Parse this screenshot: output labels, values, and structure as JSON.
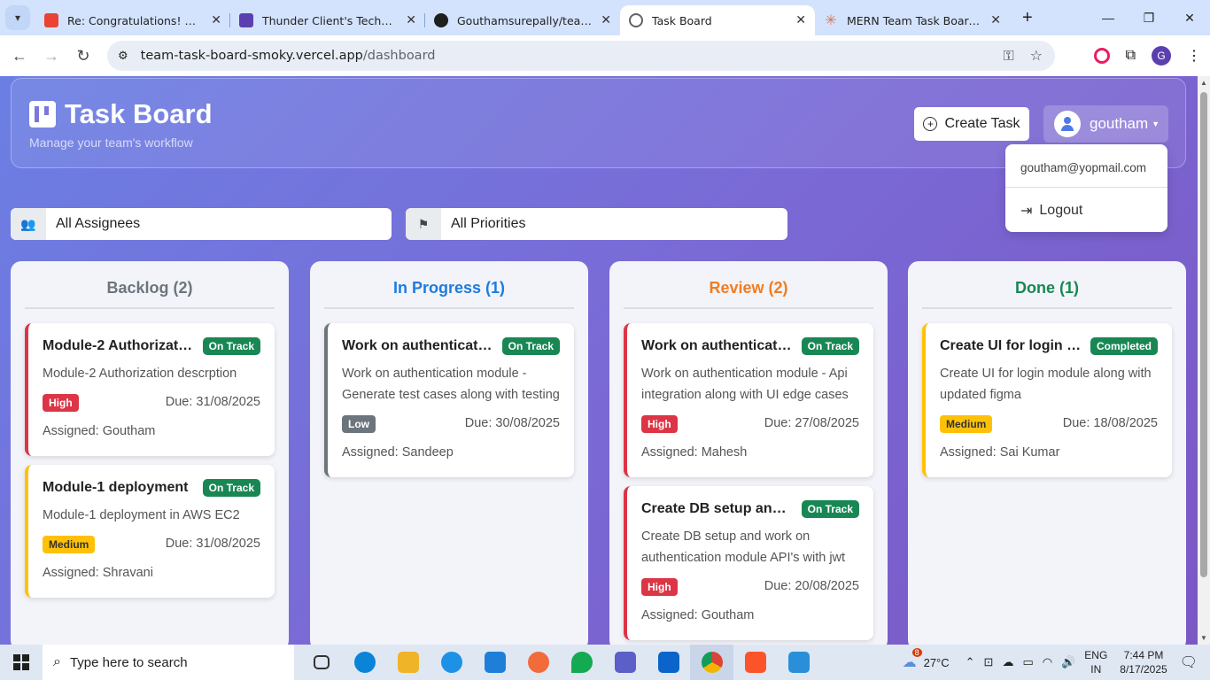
{
  "browser": {
    "tabs": [
      {
        "title": "Re: Congratulations! Next Ste",
        "favicon_color": "#ea4335",
        "icon": "gmail-icon"
      },
      {
        "title": "Thunder Client's Technical As",
        "favicon_color": "#5b3fb0",
        "icon": "thunder-client-icon"
      },
      {
        "title": "Gouthamsurepally/team-task",
        "favicon_color": "#1f1f1f",
        "icon": "github-icon"
      },
      {
        "title": "Task Board",
        "favicon_color": "#5f6368",
        "icon": "globe-icon",
        "active": true
      },
      {
        "title": "MERN Team Task Board Proje",
        "favicon_color": "#d97757",
        "icon": "claude-icon"
      }
    ],
    "url_host": "team-task-board-smoky.vercel.app",
    "url_path": "/dashboard",
    "profile_initial": "G"
  },
  "app": {
    "title": "Task Board",
    "subtitle": "Manage your team's workflow",
    "create_label": "Create Task",
    "username": "goutham",
    "menu": {
      "email": "goutham@yopmail.com",
      "logout": "Logout"
    },
    "filters": {
      "assignee": "All Assignees",
      "priority": "All Priorities"
    }
  },
  "columns": [
    {
      "title": "Backlog (2)",
      "color": "#6c757d",
      "cards": [
        {
          "title": "Module-2 Authorizati...",
          "status": "On Track",
          "desc": "Module-2 Authorization descrption",
          "priority": "High",
          "due": "Due: 31/08/2025",
          "assigned": "Assigned: Goutham"
        },
        {
          "title": "Module-1 deployment",
          "status": "On Track",
          "desc": "Module-1 deployment in AWS EC2",
          "priority": "Medium",
          "due": "Due: 31/08/2025",
          "assigned": "Assigned: Shravani"
        }
      ]
    },
    {
      "title": "In Progress (1)",
      "color": "#1c7ce0",
      "cards": [
        {
          "title": "Work on authenticati...",
          "status": "On Track",
          "desc": "Work on authentication module - Generate test cases along with testing",
          "priority": "Low",
          "due": "Due: 30/08/2025",
          "assigned": "Assigned: Sandeep"
        }
      ]
    },
    {
      "title": "Review (2)",
      "color": "#f07d22",
      "cards": [
        {
          "title": "Work on authenticati...",
          "status": "On Track",
          "desc": "Work on authentication module - Api integration along with UI edge cases",
          "priority": "High",
          "due": "Due: 27/08/2025",
          "assigned": "Assigned: Mahesh"
        },
        {
          "title": "Create DB setup and ...",
          "status": "On Track",
          "desc": "Create DB setup and work on authentication module API's with jwt",
          "priority": "High",
          "due": "Due: 20/08/2025",
          "assigned": "Assigned: Goutham"
        }
      ]
    },
    {
      "title": "Done (1)",
      "color": "#198754",
      "cards": [
        {
          "title": "Create UI for login m...",
          "status": "Completed",
          "desc": "Create UI for login module along with updated figma",
          "priority": "Medium",
          "due": "Due: 18/08/2025",
          "assigned": "Assigned: Sai Kumar"
        }
      ]
    }
  ],
  "colors": {
    "high": "#dc3545",
    "medium": "#ffc107",
    "low": "#6c757d",
    "status": "#198754"
  },
  "taskbar": {
    "search_placeholder": "Type here to search",
    "weather": "27°C",
    "lang1": "ENG",
    "lang2": "IN",
    "time": "7:44 PM",
    "date": "8/17/2025",
    "weather_badge": "8"
  }
}
